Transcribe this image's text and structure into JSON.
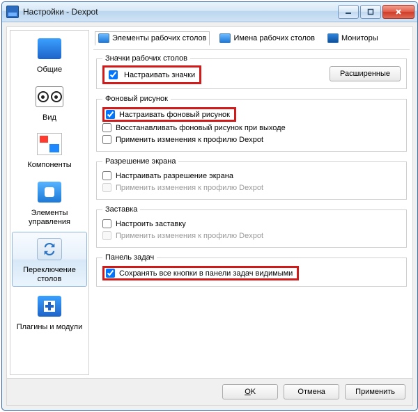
{
  "window": {
    "title": "Настройки - Dexpot"
  },
  "sidebar": {
    "items": [
      {
        "label": "Общие"
      },
      {
        "label": "Вид"
      },
      {
        "label": "Компоненты"
      },
      {
        "label": "Элементы управления"
      },
      {
        "label": "Переключение столов"
      },
      {
        "label": "Плагины и модули"
      }
    ]
  },
  "tabs": {
    "elements": "Элементы рабочих столов",
    "names": "Имена рабочих столов",
    "monitors": "Мониторы"
  },
  "groups": {
    "icons": {
      "legend": "Значки рабочих столов",
      "customize": "Настраивать значки",
      "advanced": "Расширенные"
    },
    "wallpaper": {
      "legend": "Фоновый рисунок",
      "customize": "Настраивать фоновый рисунок",
      "restore": "Восстанавливать фоновый рисунок при выходе",
      "apply_profile": "Применить изменения к профилю Dexpot"
    },
    "resolution": {
      "legend": "Разрешение экрана",
      "customize": "Настраивать разрешение экрана",
      "apply_profile": "Применить изменения к профилю Dexpot"
    },
    "screensaver": {
      "legend": "Заставка",
      "customize": "Настроить заставку",
      "apply_profile": "Применить изменения к профилю Dexpot"
    },
    "taskbar": {
      "legend": "Панель задач",
      "keep_visible": "Сохранять все кнопки в панели задач видимыми"
    }
  },
  "buttons": {
    "ok": "OK",
    "cancel": "Отмена",
    "apply": "Применить"
  }
}
